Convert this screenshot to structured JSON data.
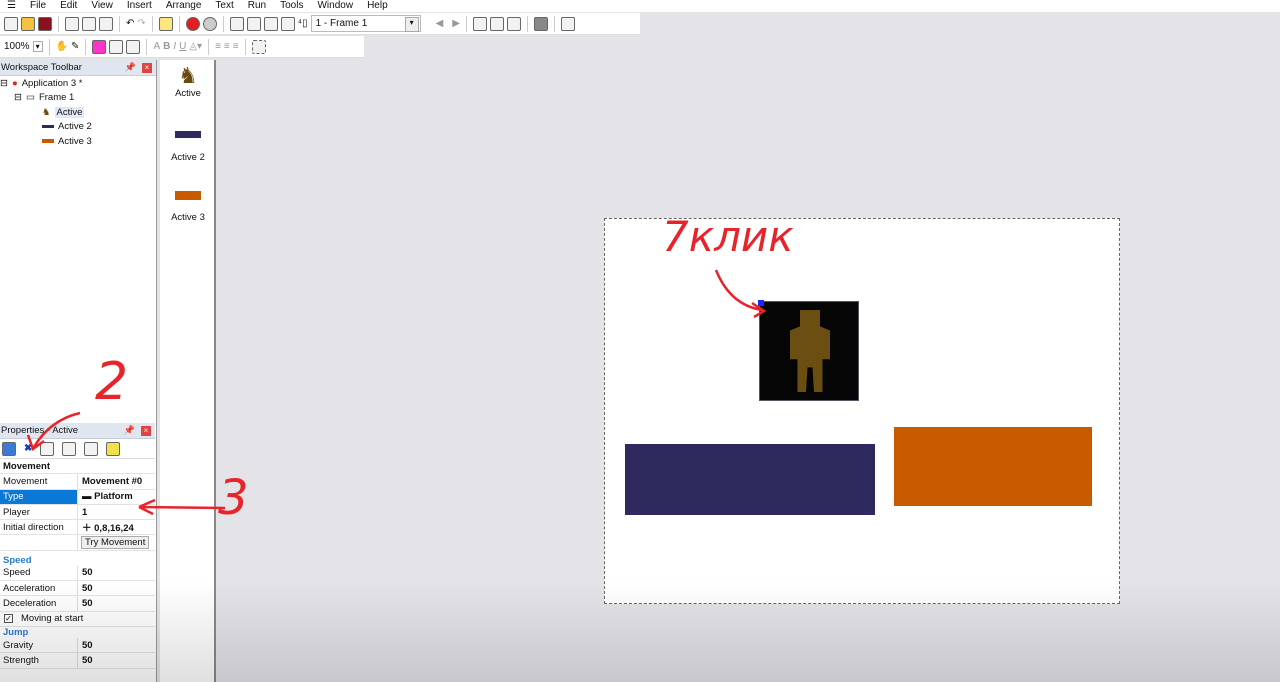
{
  "menu": [
    "File",
    "Edit",
    "View",
    "Insert",
    "Arrange",
    "Text",
    "Run",
    "Tools",
    "Window",
    "Help"
  ],
  "toolbar": {
    "frame_select": "1 - Frame 1",
    "zoom": "100%"
  },
  "workspace": {
    "title": "Workspace Toolbar",
    "app": "Application 3 *",
    "frame": "Frame 1",
    "objects": [
      "Active",
      "Active 2",
      "Active 3"
    ]
  },
  "objectbar": {
    "items": [
      "Active",
      "Active 2",
      "Active 3"
    ]
  },
  "properties": {
    "title": "Properties - Active",
    "section_movement": "Movement",
    "rows": [
      {
        "k": "Movement",
        "v": "Movement #0"
      },
      {
        "k": "Type",
        "v": "Platform"
      },
      {
        "k": "Player",
        "v": "1"
      },
      {
        "k": "Initial direction",
        "v": "0,8,16,24"
      }
    ],
    "try_button": "Try Movement",
    "section_speed": "Speed",
    "speed_rows": [
      {
        "k": "Speed",
        "v": "50"
      },
      {
        "k": "Acceleration",
        "v": "50"
      },
      {
        "k": "Deceleration",
        "v": "50"
      }
    ],
    "moving_at_start": "Moving at start",
    "section_jump": "Jump",
    "jump_rows": [
      {
        "k": "Gravity",
        "v": "50"
      },
      {
        "k": "Strength",
        "v": "50"
      }
    ]
  },
  "annotations": {
    "click": "7клик",
    "two": "2",
    "three": "3"
  },
  "colors": {
    "blue_rect": "#2e2a5e",
    "orange_rect": "#c85a00",
    "selected": "#0a78d7",
    "annotation": "#e8242b"
  }
}
